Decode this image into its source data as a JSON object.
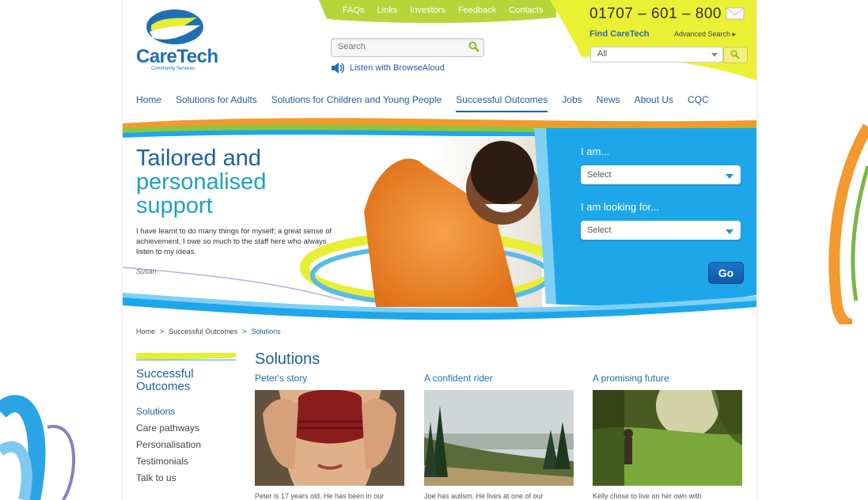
{
  "logo": {
    "name": "CareTech",
    "sub": "Community Services"
  },
  "top_links": [
    "FAQs",
    "Links",
    "Investors",
    "Feedback",
    "Contacts"
  ],
  "search": {
    "placeholder": "Search"
  },
  "listen": "Listen with BrowseAloud",
  "phone": "01707 – 601 – 800",
  "find": {
    "label": "Find CareTech",
    "advanced": "Advanced Search",
    "selected": "All"
  },
  "nav": [
    "Home",
    "Solutions for Adults",
    "Solutions for Children and Young People",
    "Successful Outcomes",
    "Jobs",
    "News",
    "About Us",
    "CQC"
  ],
  "nav_active": "Successful Outcomes",
  "hero": {
    "title_line1": "Tailored and",
    "title_line2": "personalised",
    "title_line3": "support",
    "quote": "I have learnt to do many things for myself; a great sense of achievement. I owe so much to the staff here who always listen to my ideas.",
    "author": "Susan"
  },
  "panel": {
    "iam_label": "I am...",
    "iam_value": "Select",
    "looking_label": "I am looking for...",
    "looking_value": "Select",
    "go": "Go"
  },
  "breadcrumb": [
    "Home",
    ">",
    "Successful Outcomes",
    ">",
    "Solutions"
  ],
  "sidebar": {
    "title": "Successful Outcomes",
    "items": [
      "Solutions",
      "Care pathways",
      "Personalisation",
      "Testimonials",
      "Talk to us"
    ]
  },
  "main": {
    "title": "Solutions",
    "cards": [
      {
        "title": "Peter's story",
        "caption": "Peter is 17 years old. He has been in our"
      },
      {
        "title": "A confident rider",
        "caption": "Joe has autism. He lives at one of our"
      },
      {
        "title": "A promising future",
        "caption": "Kelly chose to live on her own with"
      }
    ]
  },
  "colors": {
    "brand_blue": "#1f5fa0",
    "accent_yellow": "#e8ee33",
    "panel_blue": "#1ea6ea",
    "orange": "#f29a2e"
  }
}
